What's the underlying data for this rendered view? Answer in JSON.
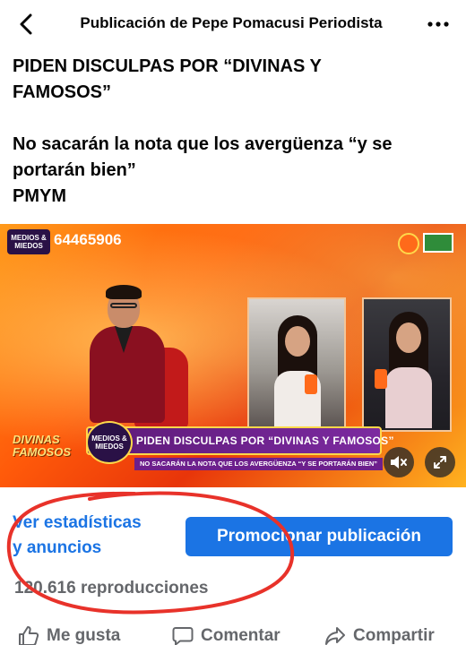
{
  "header": {
    "title": "Publicación de Pepe Pomacusi Periodista"
  },
  "post": {
    "line1": "PIDEN DISCULPAS POR “DIVINAS Y",
    "line2": "FAMOSOS”",
    "line3": "No sacarán la nota que los avergüenza “y se",
    "line4": "portarán bien”",
    "line5": "PMYM"
  },
  "video": {
    "phone": "64465906",
    "channel_logo_top": "MEDIOS &",
    "channel_logo_bottom": "MIEDOS",
    "headline": "PIDEN DISCULPAS POR “DIVINAS Y FAMOSOS”",
    "subheadline": "NO SACARÁN LA NOTA QUE LOS AVERGÜENZA “Y SE PORTARÁN BIEN”",
    "show_logo_top": "DIVINAS",
    "show_logo_bottom": "FAMOSOS",
    "mute_icon": "volume-muted-icon",
    "fullscreen_icon": "fullscreen-icon"
  },
  "stats": {
    "link_line1": "Ver estadísticas",
    "link_line2": "y anuncios",
    "promote_label": "Promocionar publicación",
    "views": "120.616 reproducciones"
  },
  "actions": {
    "like": "Me gusta",
    "comment": "Comentar",
    "share": "Compartir"
  },
  "colors": {
    "accent": "#1b74e4",
    "secondary_text": "#65676b",
    "annotation": "#e8322a"
  }
}
